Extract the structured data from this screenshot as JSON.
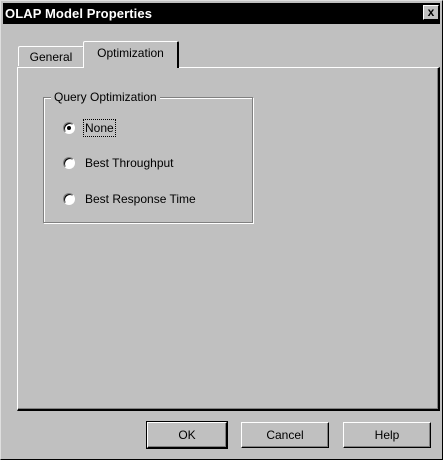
{
  "window": {
    "title": "OLAP Model Properties",
    "close_glyph": "x"
  },
  "tabs": [
    {
      "label": "General",
      "selected": false
    },
    {
      "label": "Optimization",
      "selected": true
    }
  ],
  "query_optimization": {
    "legend": "Query Optimization",
    "options": [
      {
        "label": "None",
        "selected": true
      },
      {
        "label": "Best Throughput",
        "selected": false
      },
      {
        "label": "Best Response Time",
        "selected": false
      }
    ]
  },
  "buttons": {
    "ok": "OK",
    "cancel": "Cancel",
    "help": "Help"
  }
}
